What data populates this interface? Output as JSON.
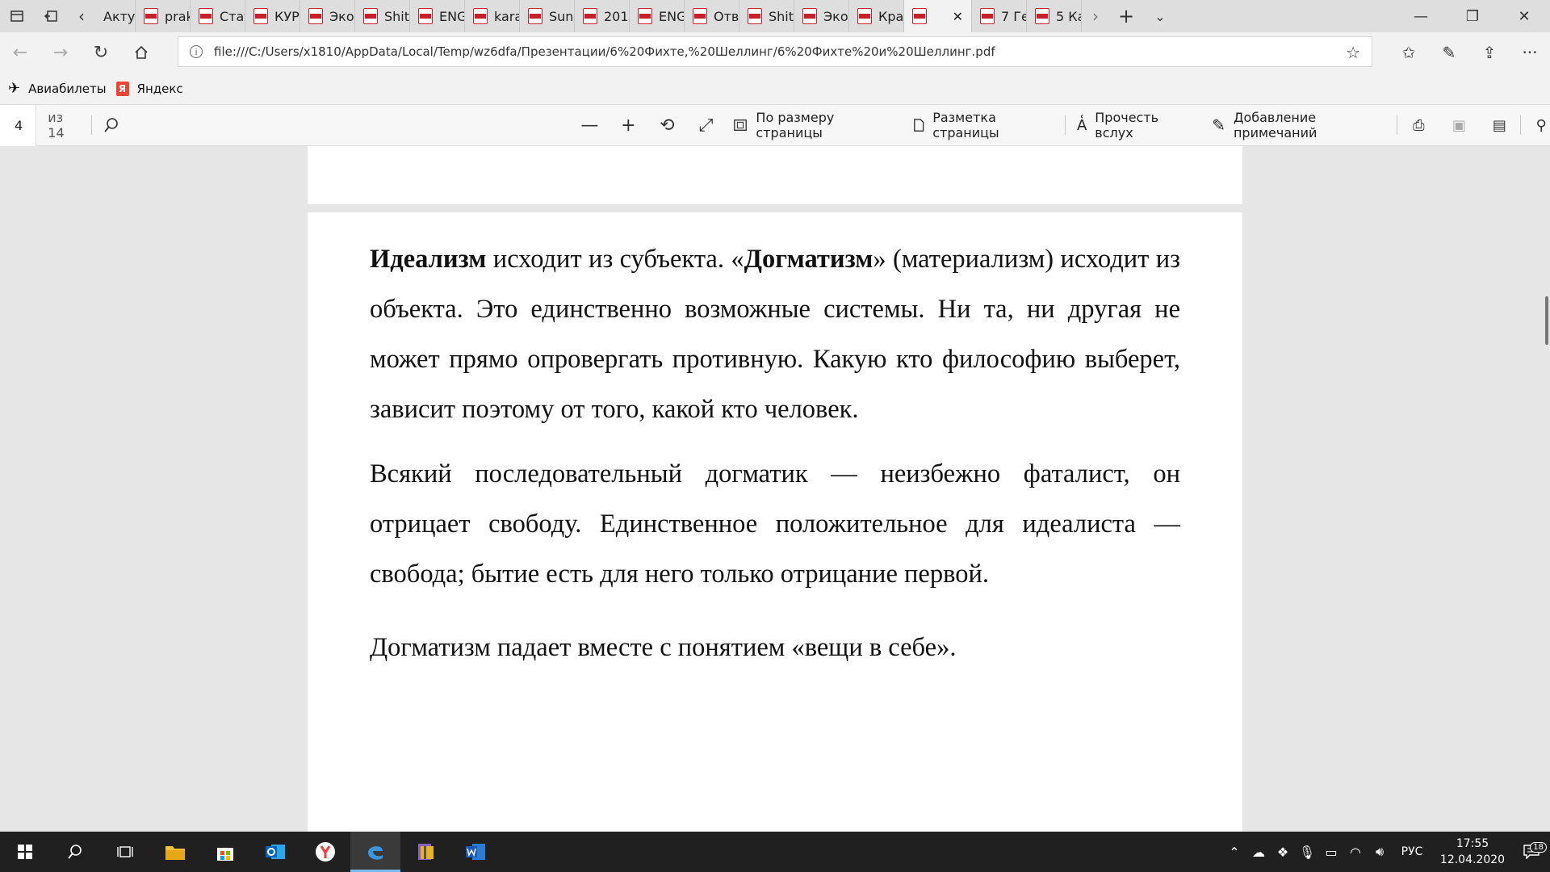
{
  "tabs": [
    {
      "label": "Акту",
      "pdf": false,
      "active": false
    },
    {
      "label": "prak",
      "pdf": true,
      "active": false
    },
    {
      "label": "Стат",
      "pdf": true,
      "active": false
    },
    {
      "label": "КУРС",
      "pdf": true,
      "active": false
    },
    {
      "label": "Эко",
      "pdf": true,
      "active": false
    },
    {
      "label": "Shit",
      "pdf": true,
      "active": false
    },
    {
      "label": "ENG",
      "pdf": true,
      "active": false
    },
    {
      "label": "kara",
      "pdf": true,
      "active": false
    },
    {
      "label": "Sun",
      "pdf": true,
      "active": false
    },
    {
      "label": "201",
      "pdf": true,
      "active": false
    },
    {
      "label": "ENG",
      "pdf": true,
      "active": false
    },
    {
      "label": "Отв",
      "pdf": true,
      "active": false
    },
    {
      "label": "Shit",
      "pdf": true,
      "active": false
    },
    {
      "label": "Эко",
      "pdf": true,
      "active": false
    },
    {
      "label": "Кра",
      "pdf": true,
      "active": false
    },
    {
      "label": "",
      "pdf": true,
      "active": true
    },
    {
      "label": "7 Ге",
      "pdf": true,
      "active": false
    },
    {
      "label": "5 Ка",
      "pdf": true,
      "active": false
    }
  ],
  "address": {
    "url": "file:///C:/Users/x1810/AppData/Local/Temp/wz6dfa/Презентации/6%20Фихте,%20Шеллинг/6%20Фихте%20и%20Шеллинг.pdf"
  },
  "favorites": [
    {
      "label": "Авиабилеты",
      "icon": "plane-icon"
    },
    {
      "label": "Яндекс",
      "icon": "yandex-icon"
    }
  ],
  "pdf_toolbar": {
    "page_number": "4",
    "page_total": "из 14",
    "fit_label": "По размеру страницы",
    "layout_label": "Разметка страницы",
    "read_aloud_label": "Прочесть вслух",
    "annotate_label": "Добавление примечаний"
  },
  "document": {
    "p1_bold1": "Идеализм",
    "p1_text1": " исходит из субъекта. «",
    "p1_bold2": "Догматизм",
    "p1_text2": "» (материализм) исходит из объекта. Это единственно возможные системы.  Ни та, ни другая не может прямо опровергать противную. Какую кто философию выберет, зависит поэтому от того, какой кто человек.",
    "p2": "Всякий последовательный догматик — неизбежно фаталист, он отрицает свободу. Единственное положительное для идеалиста — свобода; бытие есть для него только отрицание первой.",
    "p3": "Догматизм падает вместе с понятием «вещи в себе»."
  },
  "taskbar": {
    "lang": "РУС",
    "time": "17:55",
    "date": "12.04.2020",
    "notifications": "18"
  }
}
